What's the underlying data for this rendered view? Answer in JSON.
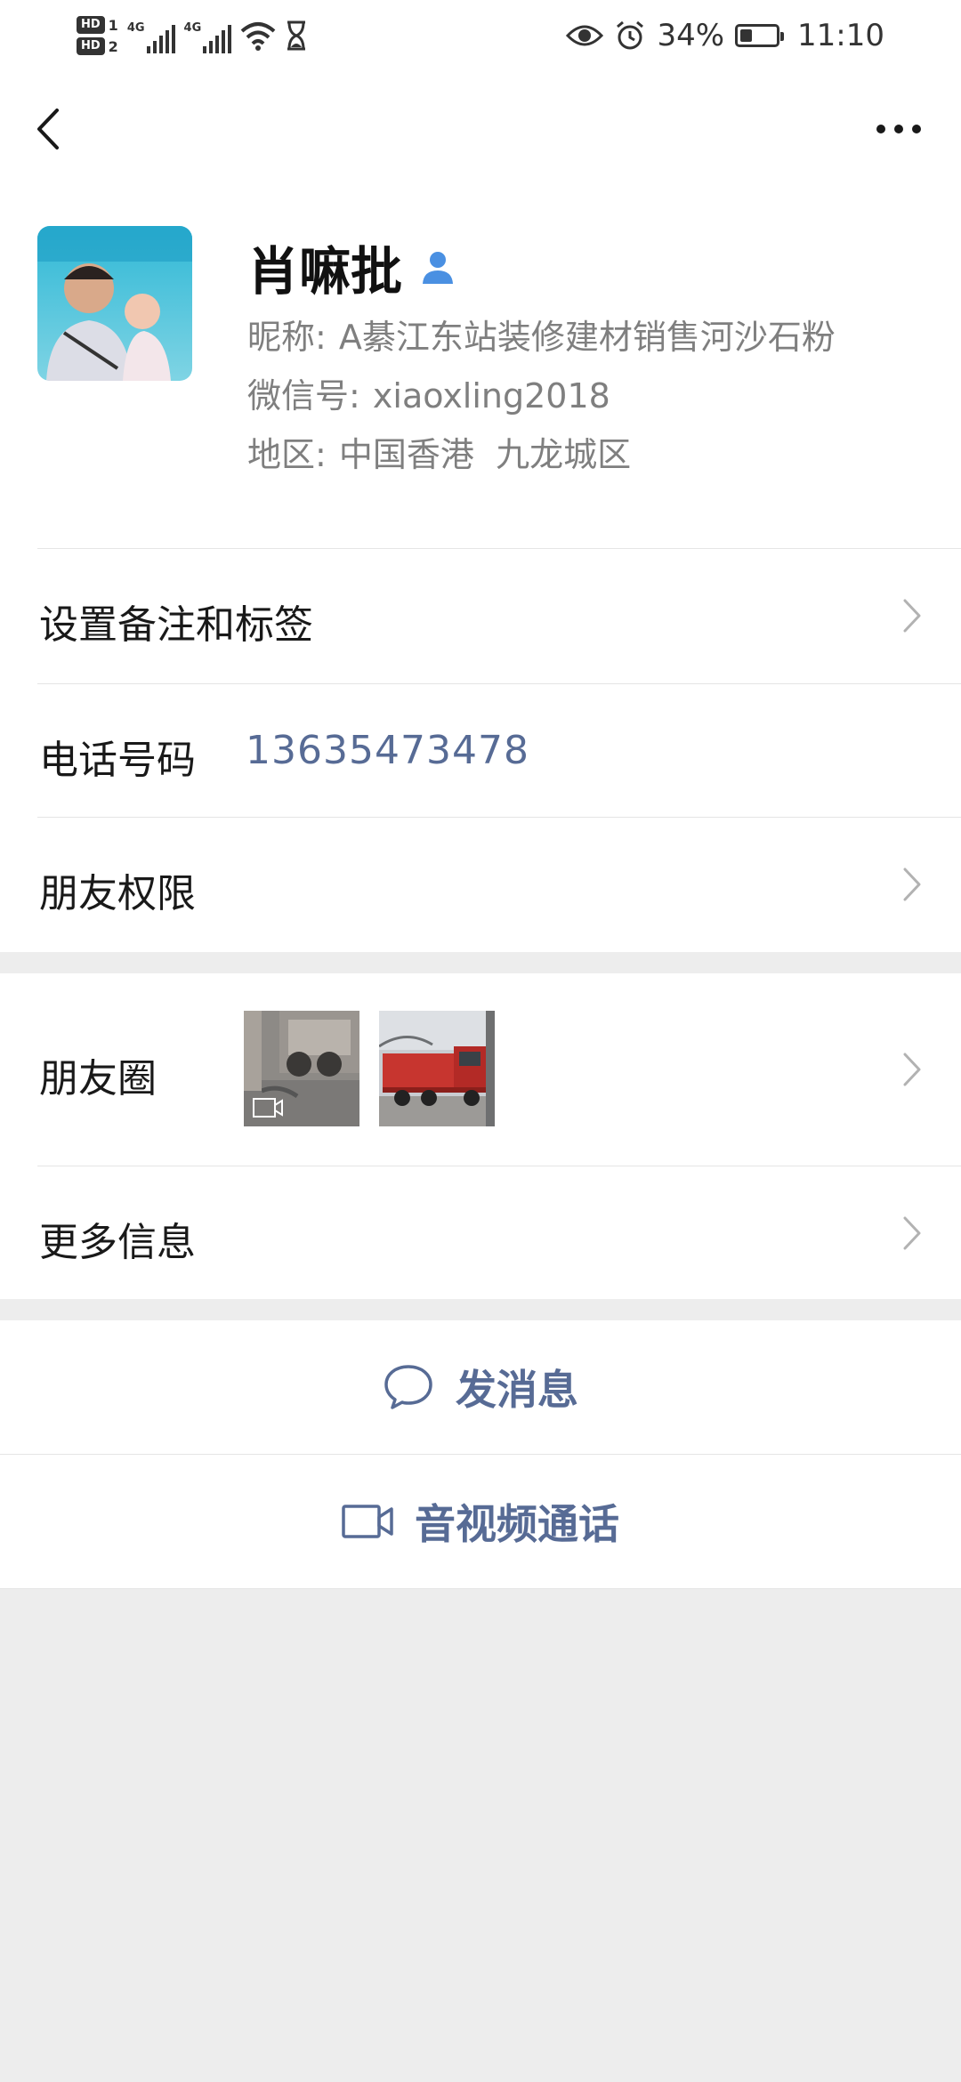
{
  "status_bar": {
    "hd1": "HD",
    "hd1_num": "1",
    "hd2": "HD",
    "hd2_num": "2",
    "net1": "4G",
    "net2": "4G",
    "battery_percent": "34%",
    "battery_level": 0.34,
    "time": "11:10"
  },
  "profile": {
    "name": "肖嘛批",
    "nickname_label": "昵称:",
    "nickname": "A綦江东站装修建材销售河沙石粉",
    "wechat_id_label": "微信号:",
    "wechat_id": "xiaoxling2018",
    "region_label": "地区:",
    "region": "中国香港  九龙城区"
  },
  "rows": {
    "remark": "设置备注和标签",
    "phone_label": "电话号码",
    "phone_value": "13635473478",
    "permissions": "朋友权限",
    "moments": "朋友圈",
    "more_info": "更多信息"
  },
  "actions": {
    "message": "发消息",
    "call": "音视频通话"
  },
  "colors": {
    "link": "#576b95",
    "background": "#ededed",
    "badge_blue": "#4a90e2"
  },
  "icons": [
    "back-icon",
    "more-icon",
    "contact-badge-icon",
    "chevron-right-icon",
    "chat-bubble-icon",
    "video-camera-icon",
    "video-thumbnail-icon",
    "eye-icon",
    "alarm-icon",
    "wifi-icon",
    "hourglass-icon",
    "battery-icon",
    "signal-icon"
  ]
}
